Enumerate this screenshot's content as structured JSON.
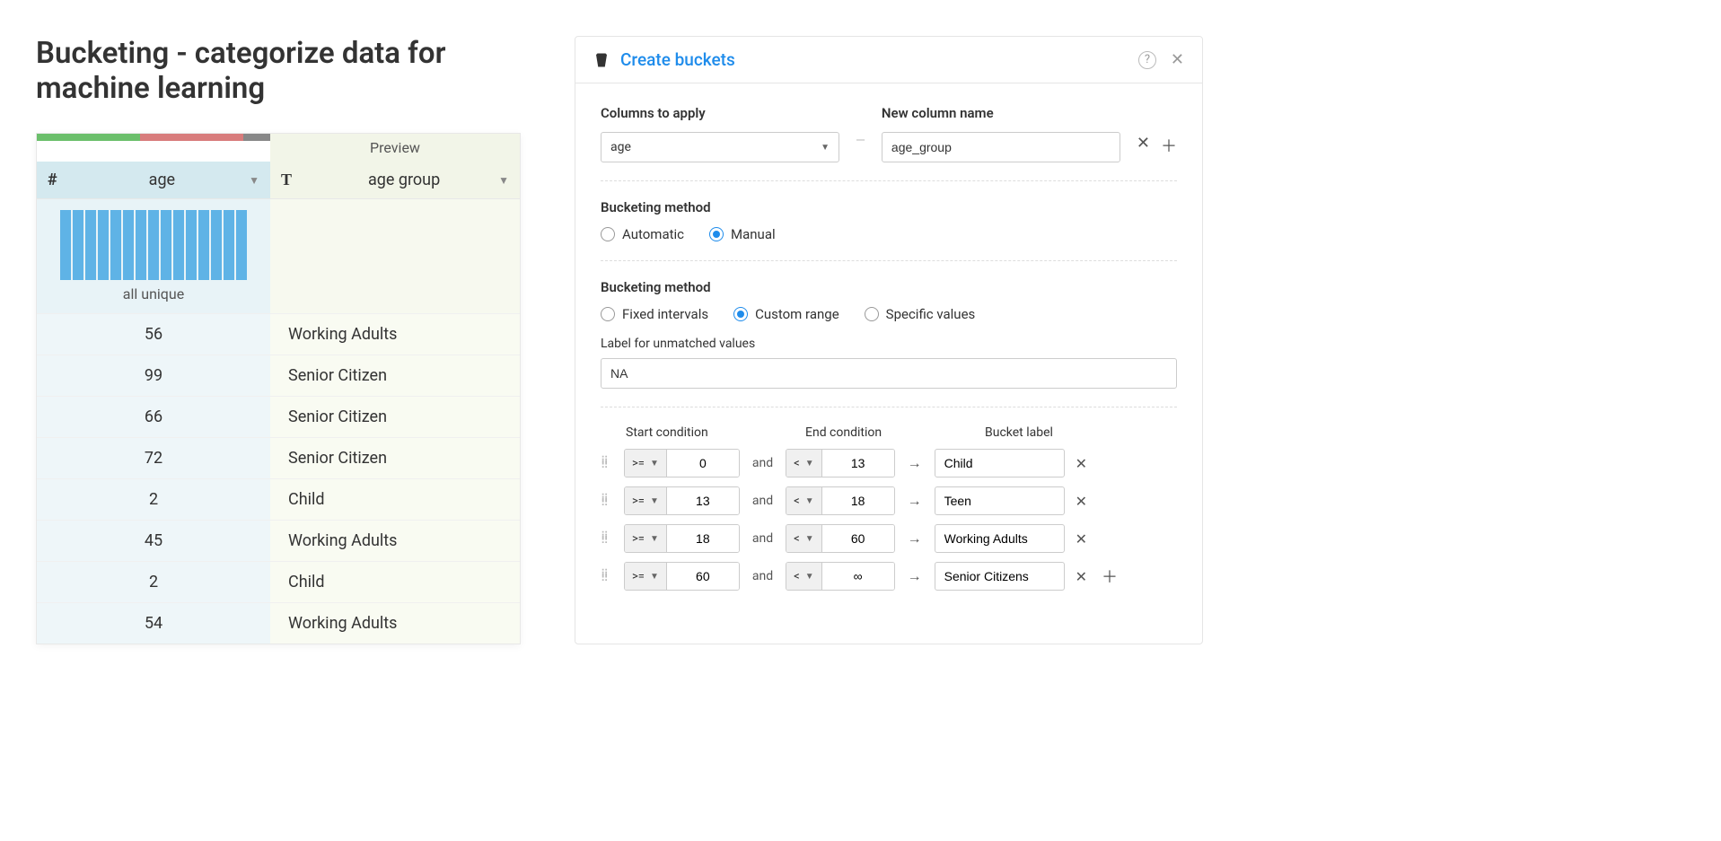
{
  "page_title": "Bucketing - categorize data for machine learning",
  "table": {
    "preview_label": "Preview",
    "columns": {
      "age": {
        "label": "age",
        "histogram_label": "all unique"
      },
      "group": {
        "label": "age group"
      }
    },
    "rows": [
      {
        "age": "56",
        "group": "Working Adults"
      },
      {
        "age": "99",
        "group": "Senior Citizen"
      },
      {
        "age": "66",
        "group": "Senior Citizen"
      },
      {
        "age": "72",
        "group": "Senior Citizen"
      },
      {
        "age": "2",
        "group": "Child"
      },
      {
        "age": "45",
        "group": "Working Adults"
      },
      {
        "age": "2",
        "group": "Child"
      },
      {
        "age": "54",
        "group": "Working Adults"
      }
    ]
  },
  "dialog": {
    "title": "Create buckets",
    "columns_to_apply_label": "Columns to apply",
    "columns_to_apply_value": "age",
    "new_column_label": "New column name",
    "new_column_value": "age_group",
    "method_label": "Bucketing method",
    "method_options": {
      "automatic": "Automatic",
      "manual": "Manual"
    },
    "range_type_label": "Bucketing method",
    "range_options": {
      "fixed": "Fixed intervals",
      "custom": "Custom range",
      "specific": "Specific values"
    },
    "unmatched_label": "Label for unmatched values",
    "unmatched_value": "NA",
    "cond_headers": {
      "start": "Start condition",
      "end": "End condition",
      "label": "Bucket label"
    },
    "and_text": "and",
    "buckets": [
      {
        "start_op": ">=",
        "start_val": "0",
        "end_op": "<",
        "end_val": "13",
        "label": "Child"
      },
      {
        "start_op": ">=",
        "start_val": "13",
        "end_op": "<",
        "end_val": "18",
        "label": "Teen"
      },
      {
        "start_op": ">=",
        "start_val": "18",
        "end_op": "<",
        "end_val": "60",
        "label": "Working Adults"
      },
      {
        "start_op": ">=",
        "start_val": "60",
        "end_op": "<",
        "end_val": "∞",
        "label": "Senior Citizens"
      }
    ]
  }
}
